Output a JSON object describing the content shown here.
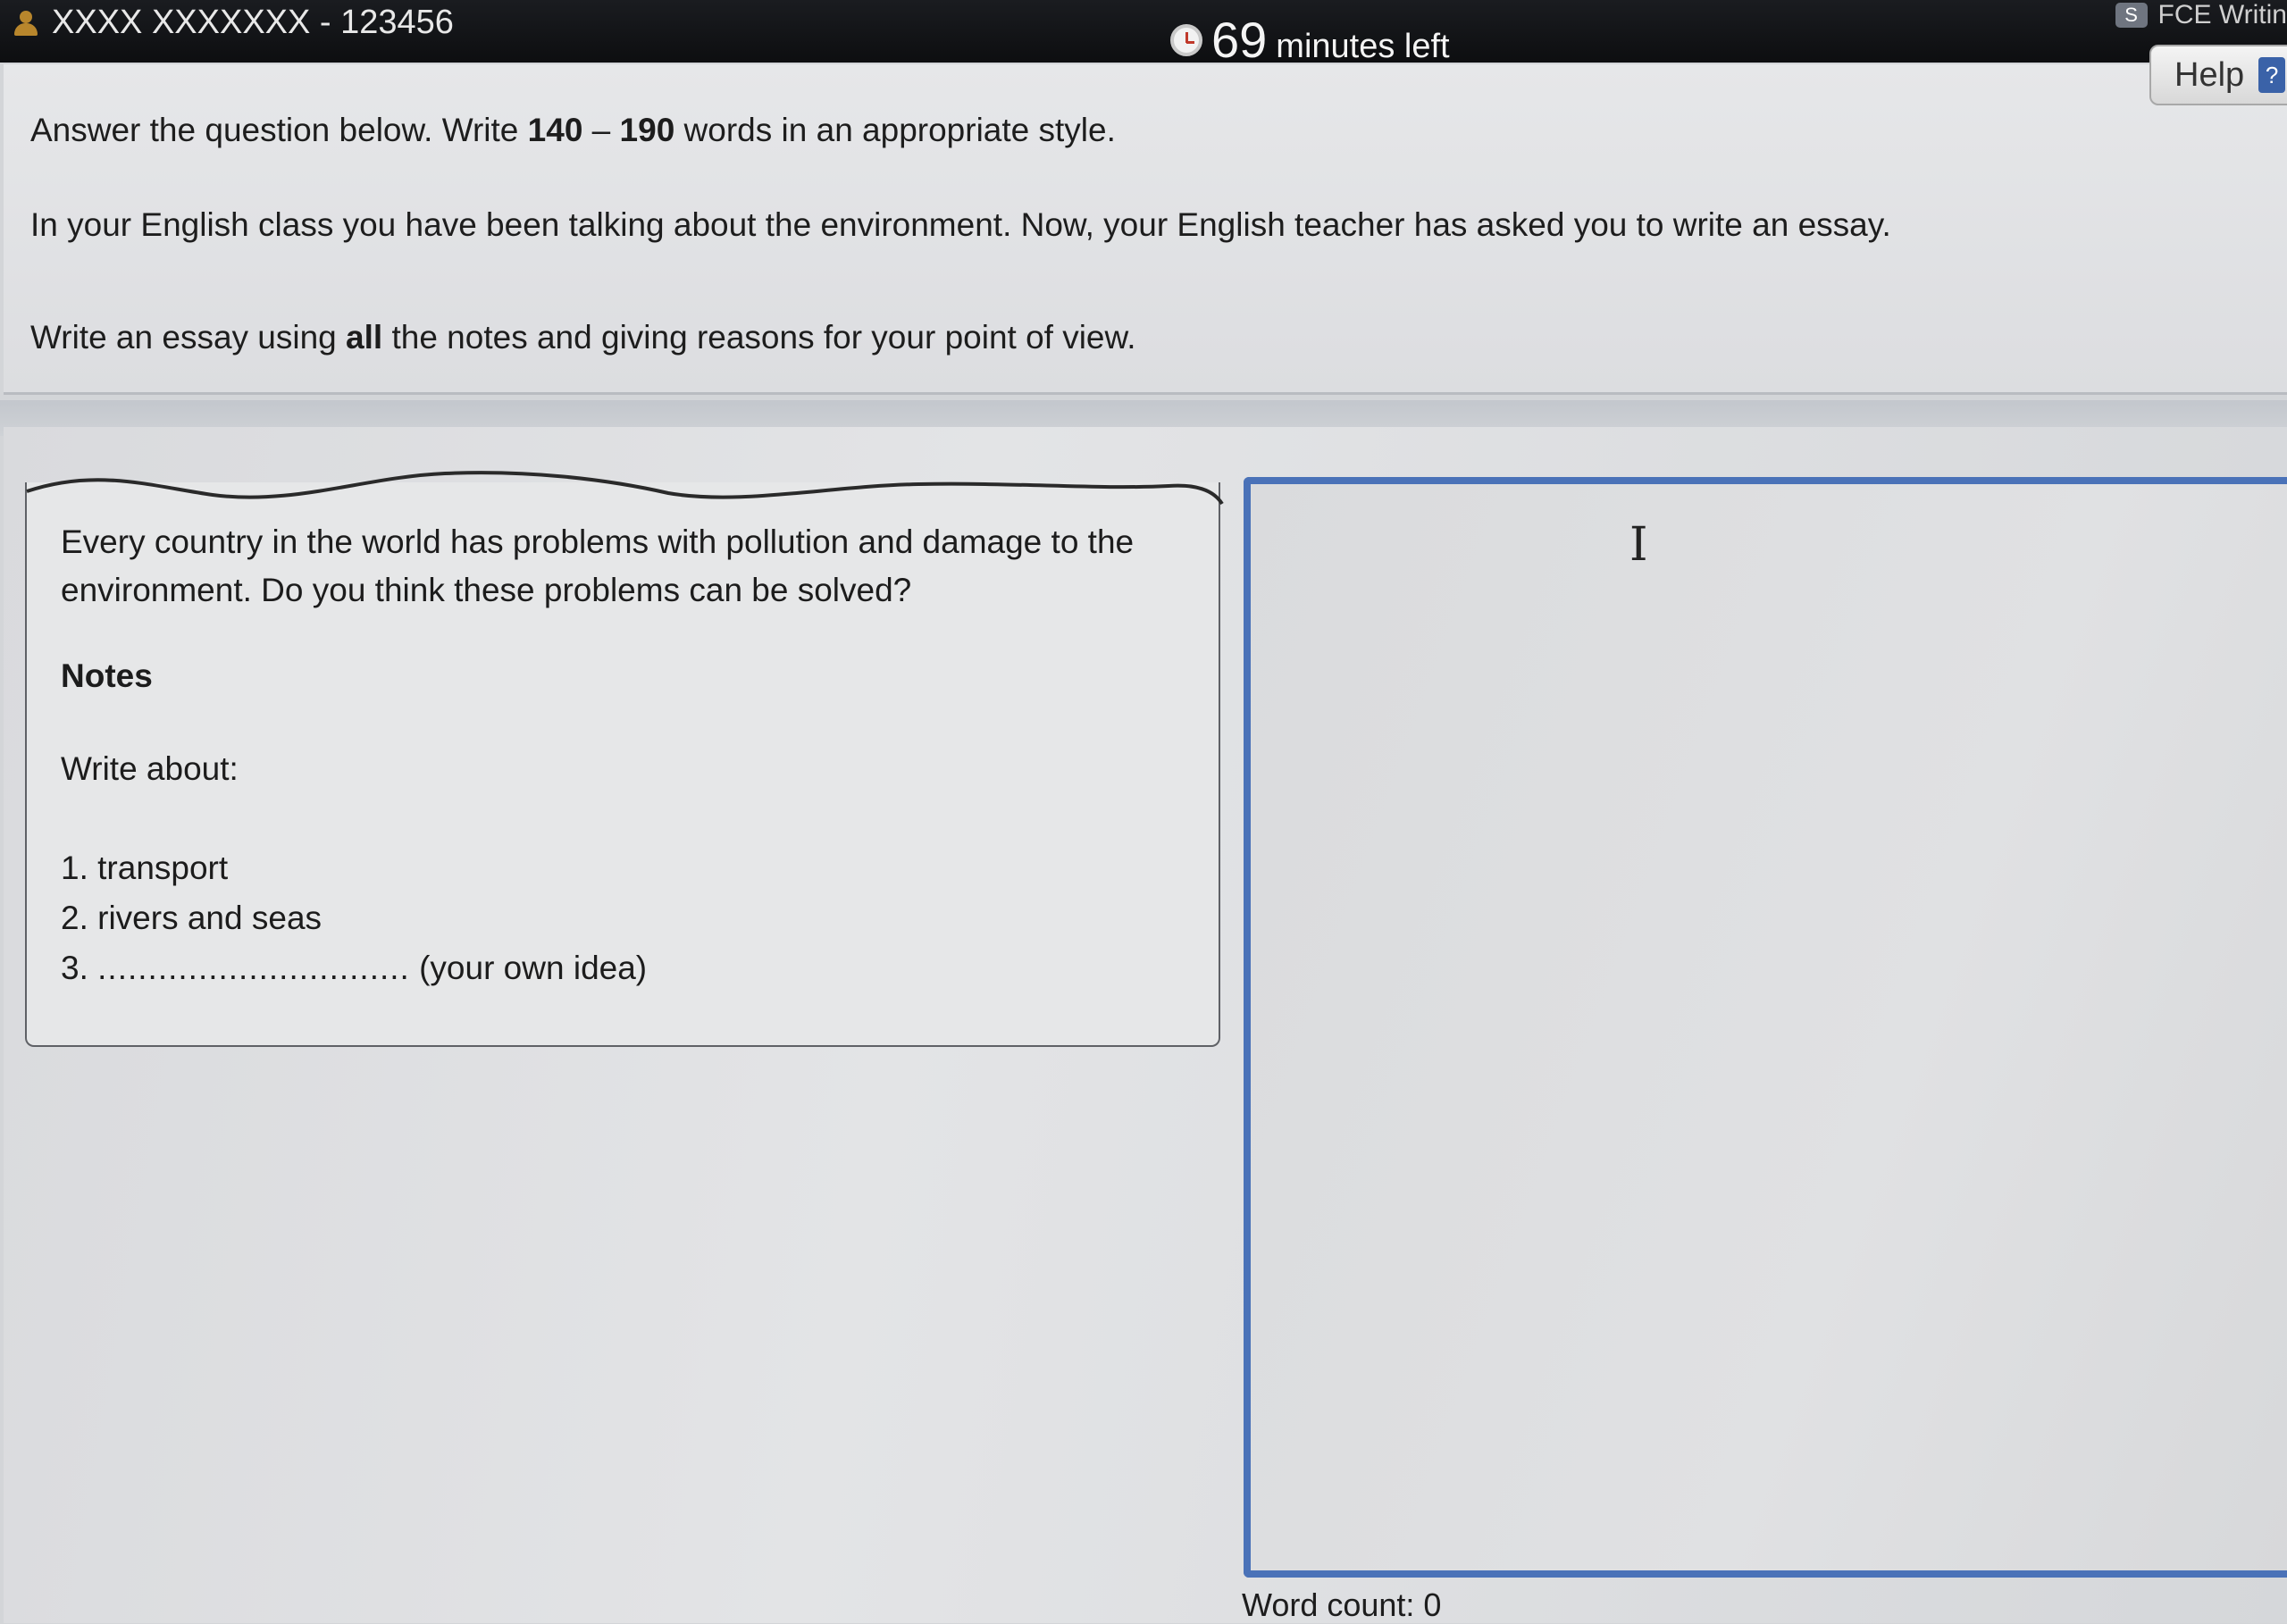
{
  "header": {
    "candidate": "XXXX XXXXXXX - 123456",
    "timer_number": "69",
    "timer_label": "minutes left",
    "task_badge": "S",
    "task_name": "FCE Writin",
    "help_label": "Help",
    "help_icon": "?",
    "icons": [
      "user-icon",
      "clock-icon",
      "help-icon"
    ]
  },
  "instructions": {
    "line1_pre": "Answer the question below. Write ",
    "line1_bold1": "140",
    "line1_dash": " – ",
    "line1_bold2": "190",
    "line1_post": " words in an appropriate style.",
    "line2": "In your English class you have been talking about the environment. Now, your English teacher has asked you to write an essay.",
    "line3_pre": "Write an essay using ",
    "line3_bold": "all",
    "line3_post": " the notes and giving reasons for your point of view."
  },
  "prompt": {
    "question": "Every country in the world has problems with pollution and damage to the environment. Do you think these problems can be solved?",
    "notes_heading": "Notes",
    "write_about": "Write about:",
    "items": [
      "1. transport",
      "2. rivers and seas"
    ],
    "item3_number": "3.",
    "item3_dots": "...............................",
    "item3_suffix": "(your own idea)"
  },
  "answer": {
    "value": "",
    "word_count": "Word count: 0"
  },
  "colors": {
    "header_bg": "#0d0e10",
    "answer_border": "#4a72b8",
    "page_bg": "#d3d5d8"
  }
}
